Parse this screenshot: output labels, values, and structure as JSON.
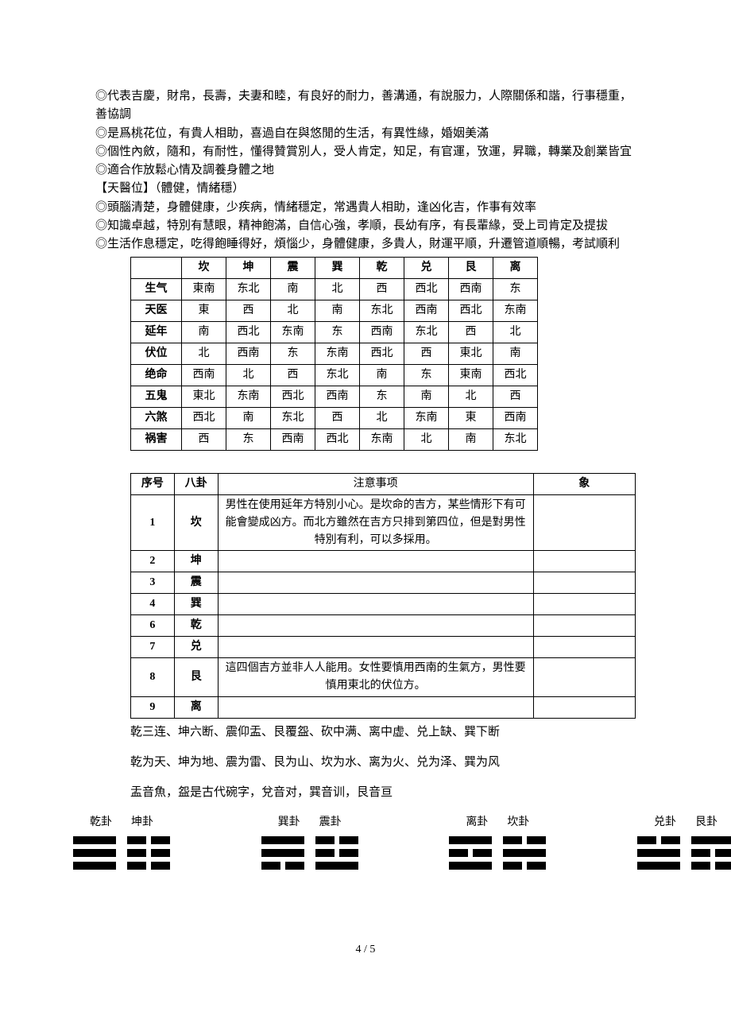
{
  "paragraphs": {
    "p1": "◎代表吉慶，財帛，長壽，夫妻和睦，有良好的耐力，善溝通，有說服力，人際關係和諧，行事穩重，善協調",
    "p2": "◎是爲桃花位，有貴人相助，喜過自在與悠閒的生活，有異性緣，婚姻美滿",
    "p3": "◎個性內斂，隨和，有耐性，懂得贊賞別人，受人肯定，知足，有官運，攷運，昇職，轉業及創業皆宜",
    "p4": "◎適合作放鬆心情及調養身體之地",
    "p5": "【天醫位】（體健，情緒穩）",
    "p6": "◎頭腦清楚，身體健康，少疾病，情緒穩定，常遇貴人相助，逢凶化吉，作事有效率",
    "p7": "◎知識卓越，特別有慧眼，精神飽滿，自信心強，孝順，長幼有序，有長輩緣，受上司肯定及提拔",
    "p8": "◎生活作息穩定，吃得飽睡得好，煩惱少，身體健康，多貴人，財運平順，升遷管道順暢，考試順利"
  },
  "table1": {
    "headers": [
      "",
      "坎",
      "坤",
      "震",
      "巽",
      "乾",
      "兑",
      "艮",
      "离"
    ],
    "rows": [
      {
        "label": "生气",
        "cells": [
          "東南",
          "东北",
          "南",
          "北",
          "西",
          "西北",
          "西南",
          "东"
        ]
      },
      {
        "label": "天医",
        "cells": [
          "東",
          "西",
          "北",
          "南",
          "东北",
          "西南",
          "西北",
          "东南"
        ]
      },
      {
        "label": "延年",
        "cells": [
          "南",
          "西北",
          "东南",
          "东",
          "西南",
          "东北",
          "西",
          "北"
        ]
      },
      {
        "label": "伏位",
        "cells": [
          "北",
          "西南",
          "东",
          "东南",
          "西北",
          "西",
          "東北",
          "南"
        ]
      },
      {
        "label": "绝命",
        "cells": [
          "西南",
          "北",
          "西",
          "东北",
          "南",
          "东",
          "東南",
          "西北"
        ]
      },
      {
        "label": "五鬼",
        "cells": [
          "東北",
          "东南",
          "西北",
          "西南",
          "东",
          "南",
          "北",
          "西"
        ]
      },
      {
        "label": "六煞",
        "cells": [
          "西北",
          "南",
          "东北",
          "西",
          "北",
          "东南",
          "東",
          "西南"
        ]
      },
      {
        "label": "祸害",
        "cells": [
          "西",
          "东",
          "西南",
          "西北",
          "东南",
          "北",
          "南",
          "东北"
        ]
      }
    ]
  },
  "table2": {
    "headers": [
      "序号",
      "八卦",
      "注意事项",
      "象"
    ],
    "rows": [
      {
        "no": "1",
        "gua": "坎",
        "note": "男性在使用延年方特別小心。是坎命的吉方，某些情形下有可能會變成凶方。而北方雖然在吉方只排到第四位，但是對男性特別有利，可以多採用。",
        "xiang": ""
      },
      {
        "no": "2",
        "gua": "坤",
        "note": "",
        "xiang": ""
      },
      {
        "no": "3",
        "gua": "震",
        "note": "",
        "xiang": ""
      },
      {
        "no": "4",
        "gua": "巽",
        "note": "",
        "xiang": ""
      },
      {
        "no": "6",
        "gua": "乾",
        "note": "",
        "xiang": ""
      },
      {
        "no": "7",
        "gua": "兑",
        "note": "",
        "xiang": ""
      },
      {
        "no": "8",
        "gua": "艮",
        "note": "這四個吉方並非人人能用。女性要慎用西南的生氣方，男性要慎用東北的伏位方。",
        "xiang": ""
      },
      {
        "no": "9",
        "gua": "离",
        "note": "",
        "xiang": ""
      }
    ]
  },
  "mnemonic": {
    "m1": "乾三连、坤六断、震仰盂、艮覆盌、砍中满、离中虚、兑上缺、巽下断",
    "m2": "乾为天、坤为地、震为雷、艮为山、坎为水、离为火、兑为泽、巽为风",
    "m3": "盂音魚，盌是古代碗字，兌音对，巽音训，艮音亘"
  },
  "gua_labels": {
    "qian": "乾卦",
    "kun": "坤卦",
    "xun": "巽卦",
    "zhen": "震卦",
    "li": "离卦",
    "kan": "坎卦",
    "dui": "兑卦",
    "gen": "艮卦"
  },
  "gua_lines": {
    "qian": [
      "solid",
      "solid",
      "solid"
    ],
    "kun": [
      "broken",
      "broken",
      "broken"
    ],
    "xun": [
      "solid",
      "solid",
      "broken"
    ],
    "zhen": [
      "broken",
      "broken",
      "solid"
    ],
    "li": [
      "solid",
      "broken",
      "solid"
    ],
    "kan": [
      "broken",
      "solid",
      "broken"
    ],
    "dui": [
      "broken",
      "solid",
      "solid"
    ],
    "gen": [
      "solid",
      "broken",
      "broken"
    ]
  },
  "page": "4 / 5"
}
